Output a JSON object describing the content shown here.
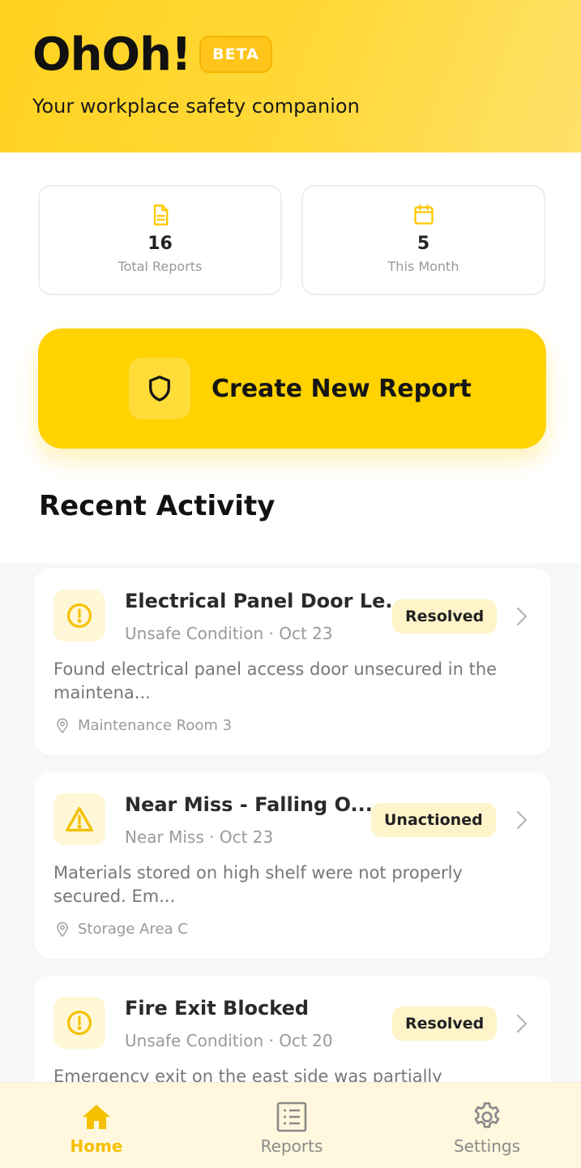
{
  "header": {
    "title": "OhOh!",
    "badge": "BETA",
    "subtitle": "Your workplace safety companion"
  },
  "stats": [
    {
      "icon": "document-icon",
      "value": "16",
      "label": "Total Reports"
    },
    {
      "icon": "calendar-icon",
      "value": "5",
      "label": "This Month"
    }
  ],
  "create_button": {
    "icon": "shield-icon",
    "label": "Create New Report"
  },
  "recent_activity": {
    "title": "Recent Activity",
    "items": [
      {
        "icon": "alert-circle-icon",
        "title": "Electrical Panel Door Le...",
        "meta": "Unsafe Condition · Oct 23",
        "status": "Resolved",
        "description": "Found electrical panel access door unsecured in the maintena...",
        "location": "Maintenance Room 3"
      },
      {
        "icon": "warning-triangle-icon",
        "title": "Near Miss - Falling O...",
        "meta": "Near Miss · Oct 23",
        "status": "Unactioned",
        "description": "Materials stored on high shelf were not properly secured. Em...",
        "location": "Storage Area C"
      },
      {
        "icon": "alert-circle-icon",
        "title": "Fire Exit Blocked",
        "meta": "Unsafe Condition · Oct 20",
        "status": "Resolved",
        "description": "Emergency exit on the east side was partially",
        "location": ""
      }
    ]
  },
  "bottom_nav": {
    "active": "Home",
    "items": [
      {
        "icon": "home-icon",
        "label": "Home"
      },
      {
        "icon": "list-icon",
        "label": "Reports"
      },
      {
        "icon": "gear-icon",
        "label": "Settings"
      }
    ]
  },
  "colors": {
    "accent": "#FFD200",
    "header_bg": "#FFD52B",
    "badge_bg": "#FFC51A",
    "status_bg": "#FFF4C9",
    "nav_bg": "#FFF8DE",
    "active_nav": "#F6C000"
  }
}
